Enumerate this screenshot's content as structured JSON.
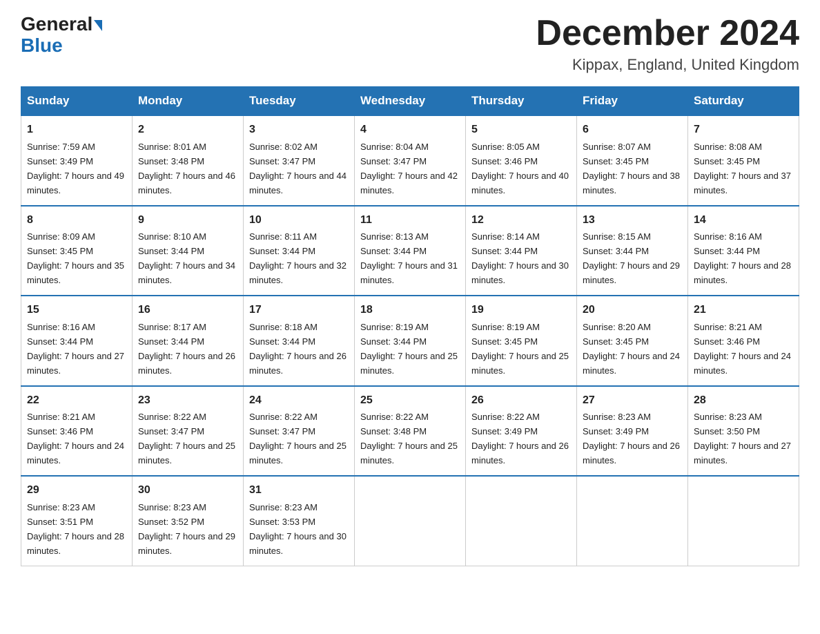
{
  "logo": {
    "text1": "General",
    "text2": "Blue"
  },
  "header": {
    "month": "December 2024",
    "location": "Kippax, England, United Kingdom"
  },
  "weekdays": [
    "Sunday",
    "Monday",
    "Tuesday",
    "Wednesday",
    "Thursday",
    "Friday",
    "Saturday"
  ],
  "weeks": [
    [
      {
        "day": "1",
        "sunrise": "7:59 AM",
        "sunset": "3:49 PM",
        "daylight": "7 hours and 49 minutes."
      },
      {
        "day": "2",
        "sunrise": "8:01 AM",
        "sunset": "3:48 PM",
        "daylight": "7 hours and 46 minutes."
      },
      {
        "day": "3",
        "sunrise": "8:02 AM",
        "sunset": "3:47 PM",
        "daylight": "7 hours and 44 minutes."
      },
      {
        "day": "4",
        "sunrise": "8:04 AM",
        "sunset": "3:47 PM",
        "daylight": "7 hours and 42 minutes."
      },
      {
        "day": "5",
        "sunrise": "8:05 AM",
        "sunset": "3:46 PM",
        "daylight": "7 hours and 40 minutes."
      },
      {
        "day": "6",
        "sunrise": "8:07 AM",
        "sunset": "3:45 PM",
        "daylight": "7 hours and 38 minutes."
      },
      {
        "day": "7",
        "sunrise": "8:08 AM",
        "sunset": "3:45 PM",
        "daylight": "7 hours and 37 minutes."
      }
    ],
    [
      {
        "day": "8",
        "sunrise": "8:09 AM",
        "sunset": "3:45 PM",
        "daylight": "7 hours and 35 minutes."
      },
      {
        "day": "9",
        "sunrise": "8:10 AM",
        "sunset": "3:44 PM",
        "daylight": "7 hours and 34 minutes."
      },
      {
        "day": "10",
        "sunrise": "8:11 AM",
        "sunset": "3:44 PM",
        "daylight": "7 hours and 32 minutes."
      },
      {
        "day": "11",
        "sunrise": "8:13 AM",
        "sunset": "3:44 PM",
        "daylight": "7 hours and 31 minutes."
      },
      {
        "day": "12",
        "sunrise": "8:14 AM",
        "sunset": "3:44 PM",
        "daylight": "7 hours and 30 minutes."
      },
      {
        "day": "13",
        "sunrise": "8:15 AM",
        "sunset": "3:44 PM",
        "daylight": "7 hours and 29 minutes."
      },
      {
        "day": "14",
        "sunrise": "8:16 AM",
        "sunset": "3:44 PM",
        "daylight": "7 hours and 28 minutes."
      }
    ],
    [
      {
        "day": "15",
        "sunrise": "8:16 AM",
        "sunset": "3:44 PM",
        "daylight": "7 hours and 27 minutes."
      },
      {
        "day": "16",
        "sunrise": "8:17 AM",
        "sunset": "3:44 PM",
        "daylight": "7 hours and 26 minutes."
      },
      {
        "day": "17",
        "sunrise": "8:18 AM",
        "sunset": "3:44 PM",
        "daylight": "7 hours and 26 minutes."
      },
      {
        "day": "18",
        "sunrise": "8:19 AM",
        "sunset": "3:44 PM",
        "daylight": "7 hours and 25 minutes."
      },
      {
        "day": "19",
        "sunrise": "8:19 AM",
        "sunset": "3:45 PM",
        "daylight": "7 hours and 25 minutes."
      },
      {
        "day": "20",
        "sunrise": "8:20 AM",
        "sunset": "3:45 PM",
        "daylight": "7 hours and 24 minutes."
      },
      {
        "day": "21",
        "sunrise": "8:21 AM",
        "sunset": "3:46 PM",
        "daylight": "7 hours and 24 minutes."
      }
    ],
    [
      {
        "day": "22",
        "sunrise": "8:21 AM",
        "sunset": "3:46 PM",
        "daylight": "7 hours and 24 minutes."
      },
      {
        "day": "23",
        "sunrise": "8:22 AM",
        "sunset": "3:47 PM",
        "daylight": "7 hours and 25 minutes."
      },
      {
        "day": "24",
        "sunrise": "8:22 AM",
        "sunset": "3:47 PM",
        "daylight": "7 hours and 25 minutes."
      },
      {
        "day": "25",
        "sunrise": "8:22 AM",
        "sunset": "3:48 PM",
        "daylight": "7 hours and 25 minutes."
      },
      {
        "day": "26",
        "sunrise": "8:22 AM",
        "sunset": "3:49 PM",
        "daylight": "7 hours and 26 minutes."
      },
      {
        "day": "27",
        "sunrise": "8:23 AM",
        "sunset": "3:49 PM",
        "daylight": "7 hours and 26 minutes."
      },
      {
        "day": "28",
        "sunrise": "8:23 AM",
        "sunset": "3:50 PM",
        "daylight": "7 hours and 27 minutes."
      }
    ],
    [
      {
        "day": "29",
        "sunrise": "8:23 AM",
        "sunset": "3:51 PM",
        "daylight": "7 hours and 28 minutes."
      },
      {
        "day": "30",
        "sunrise": "8:23 AM",
        "sunset": "3:52 PM",
        "daylight": "7 hours and 29 minutes."
      },
      {
        "day": "31",
        "sunrise": "8:23 AM",
        "sunset": "3:53 PM",
        "daylight": "7 hours and 30 minutes."
      },
      null,
      null,
      null,
      null
    ]
  ],
  "labels": {
    "sunrise_prefix": "Sunrise: ",
    "sunset_prefix": "Sunset: ",
    "daylight_prefix": "Daylight: "
  }
}
